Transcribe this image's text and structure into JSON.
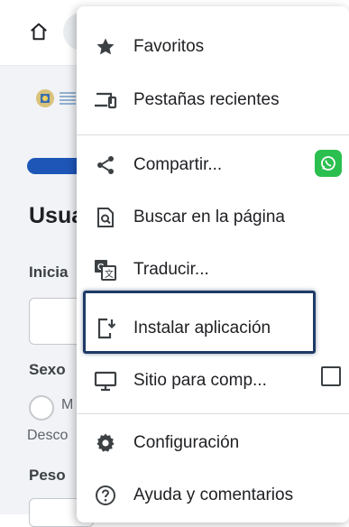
{
  "background_page": {
    "heading": "Usua",
    "field_label_1": "Inicia",
    "field_label_2": "Sexo",
    "radio_option": "M",
    "secondary_text": "Desco",
    "field_label_3": "Peso"
  },
  "menu": {
    "items": [
      {
        "label": "Favoritos",
        "icon": "star-icon"
      },
      {
        "label": "Pestañas recientes",
        "icon": "devices-icon"
      },
      {
        "label": "Compartir...",
        "icon": "share-icon"
      },
      {
        "label": "Buscar en la página",
        "icon": "find-in-page-icon"
      },
      {
        "label": "Traducir...",
        "icon": "translate-icon"
      },
      {
        "label": "Instalar aplicación",
        "icon": "install-app-icon"
      },
      {
        "label": "Sitio para comp...",
        "icon": "desktop-icon"
      },
      {
        "label": "Configuración",
        "icon": "gear-icon"
      },
      {
        "label": "Ayuda y comentarios",
        "icon": "help-icon"
      }
    ],
    "desktop_site_checked": false
  },
  "colors": {
    "accent": "#1e56b8",
    "highlight_border": "#1f3a66",
    "whatsapp": "#2bbf4f"
  }
}
